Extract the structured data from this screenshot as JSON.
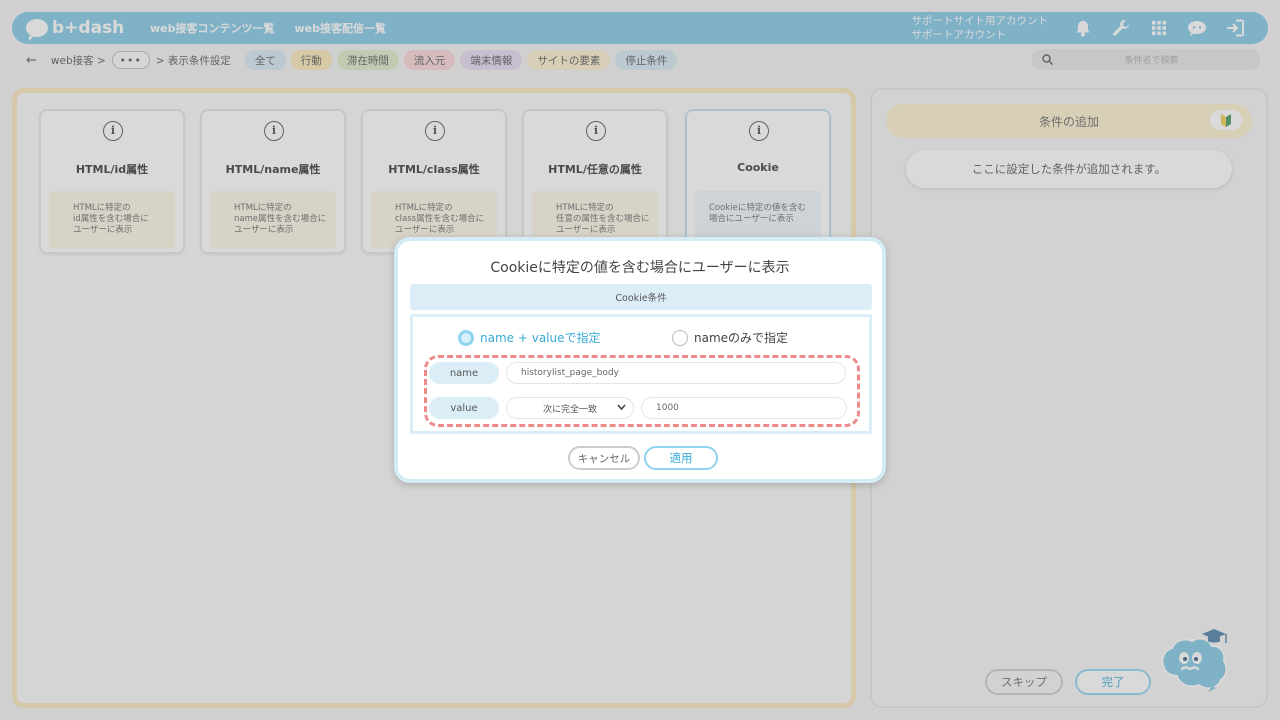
{
  "header": {
    "logo_text": "b+dash",
    "nav": [
      "web接客コンテンツ一覧",
      "web接客配信一覧"
    ],
    "account_line1": "サポートサイト用アカウント",
    "account_line2": "サポートアカウント",
    "icons": [
      "bell-icon",
      "wrench-icon",
      "grid-icon",
      "chat-icon",
      "logout-icon"
    ]
  },
  "breadcrumb": {
    "back": "←",
    "item1": "web接客 >",
    "more": "•••",
    "item2": "> 表示条件設定"
  },
  "filters": [
    {
      "label": "全て",
      "bg": "#d6e9f4"
    },
    {
      "label": "行動",
      "bg": "#fbe8b6"
    },
    {
      "label": "滞在時間",
      "bg": "#dcedc8"
    },
    {
      "label": "流入元",
      "bg": "#f9d4d4"
    },
    {
      "label": "端末情報",
      "bg": "#e6d9f2"
    },
    {
      "label": "サイトの要素",
      "bg": "#fcefce"
    },
    {
      "label": "停止条件",
      "bg": "#d6e9f4"
    }
  ],
  "search": {
    "placeholder": "条件名で検索"
  },
  "cards": [
    {
      "title": "HTML/id属性",
      "desc": [
        "HTMLに特定の",
        "id属性を含む場合に",
        "ユーザーに表示"
      ]
    },
    {
      "title": "HTML/name属性",
      "desc": [
        "HTMLに特定の",
        "name属性を含む場合に",
        "ユーザーに表示"
      ]
    },
    {
      "title": "HTML/class属性",
      "desc": [
        "HTMLに特定の",
        "class属性を含む場合に",
        "ユーザーに表示"
      ]
    },
    {
      "title": "HTML/任意の属性",
      "desc": [
        "HTMLに特定の",
        "任意の属性を含む場合に",
        "ユーザーに表示"
      ]
    },
    {
      "title": "Cookie",
      "desc": [
        "Cookieに特定の値を含む",
        "場合にユーザーに表示",
        ""
      ]
    }
  ],
  "right_panel": {
    "header": "条件の追加",
    "empty_text": "ここに設定した条件が追加されます。",
    "skip": "スキップ",
    "done": "完了"
  },
  "modal": {
    "title": "Cookieに特定の値を含む場合にユーザーに表示",
    "section": "Cookie条件",
    "radio_name_value": "name + valueで指定",
    "radio_name_only": "nameのみで指定",
    "name_label": "name",
    "name_value": "historylist_page_body",
    "value_label": "value",
    "match_select": "次に完全一致",
    "value_value": "1000",
    "cancel": "キャンセル",
    "apply": "適用"
  },
  "colors": {
    "accent": "#7fc7e6",
    "dash_highlight": "#ef8a8a"
  }
}
